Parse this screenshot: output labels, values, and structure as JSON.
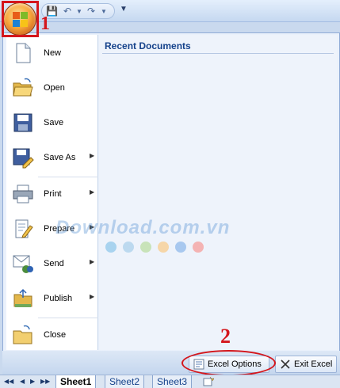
{
  "annotations": {
    "step1": "1",
    "step2": "2"
  },
  "menu": {
    "commands": [
      {
        "label": "New",
        "icon": "new-document-icon",
        "arrow": false
      },
      {
        "label": "Open",
        "icon": "open-folder-icon",
        "arrow": false
      },
      {
        "label": "Save",
        "icon": "save-disk-icon",
        "arrow": false
      },
      {
        "label": "Save As",
        "icon": "save-as-icon",
        "arrow": true
      },
      {
        "label": "Print",
        "icon": "printer-icon",
        "arrow": true
      },
      {
        "label": "Prepare",
        "icon": "prepare-icon",
        "arrow": true
      },
      {
        "label": "Send",
        "icon": "send-icon",
        "arrow": true
      },
      {
        "label": "Publish",
        "icon": "publish-icon",
        "arrow": true
      },
      {
        "label": "Close",
        "icon": "close-folder-icon",
        "arrow": false
      }
    ],
    "recent_title": "Recent Documents",
    "options_button": "Excel Options",
    "exit_button": "Exit Excel"
  },
  "watermark": {
    "text": "Download.com.vn"
  },
  "sheet_tabs": [
    "Sheet1",
    "Sheet2",
    "Sheet3"
  ],
  "colors": {
    "highlight": "#d4161c",
    "title_blue": "#15428b"
  }
}
